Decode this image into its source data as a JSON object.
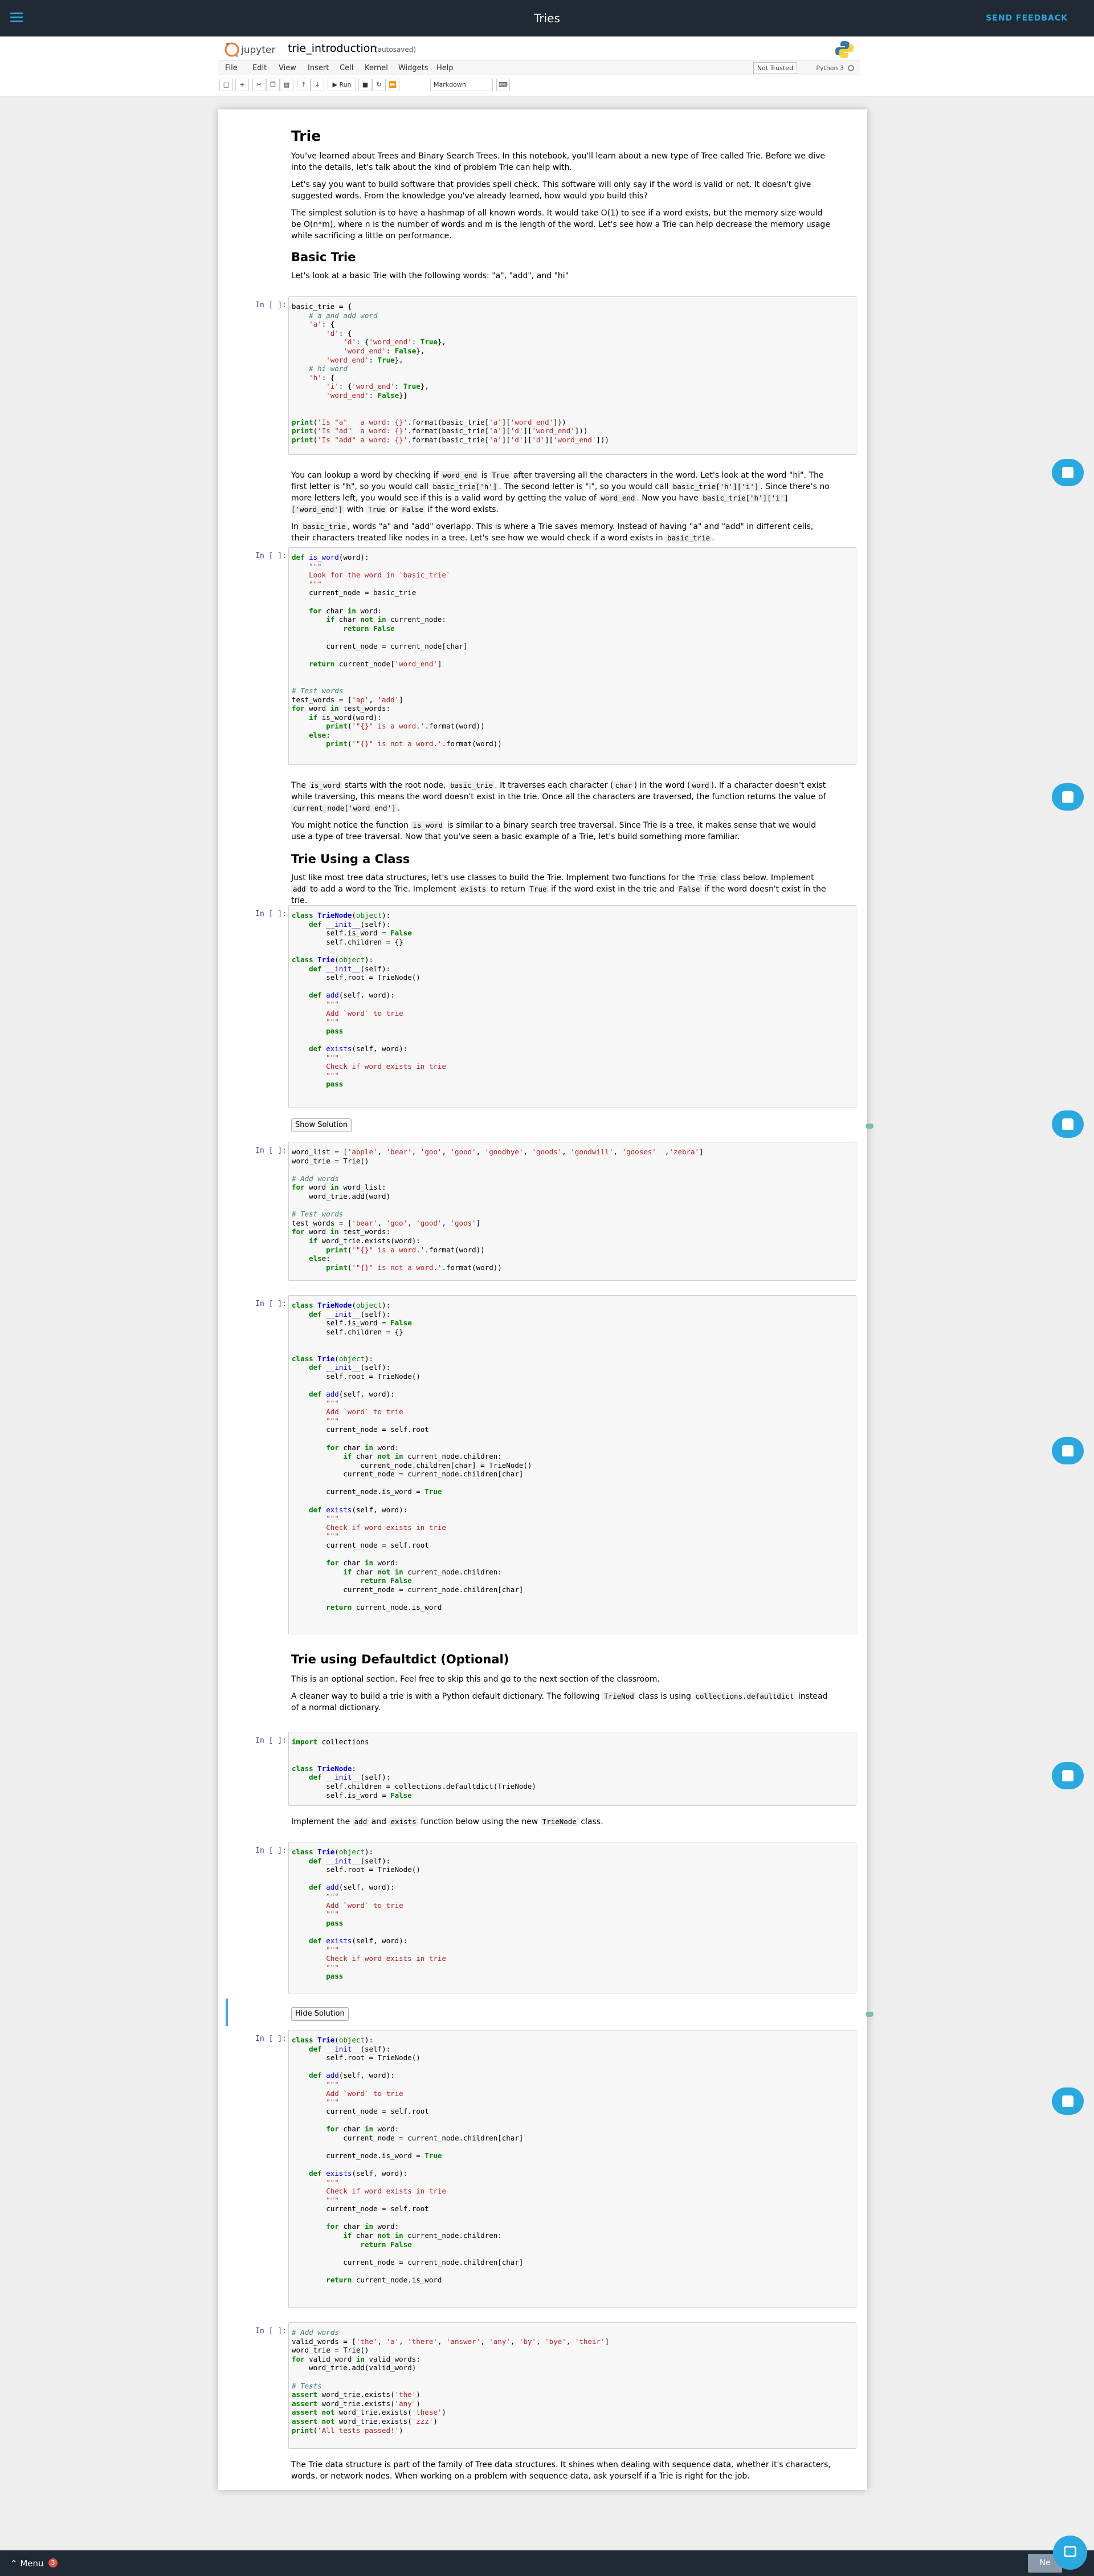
{
  "app": {
    "title": "Tries",
    "feedback": "SEND FEEDBACK",
    "menu_label": "Menu",
    "menu_badge": "3",
    "next_label": "Ne"
  },
  "notebook": {
    "logo_text": "jupyter",
    "name": "trie_introduction",
    "autosave": "(autosaved)",
    "trusted": "Not Trusted",
    "kernel": "Python 3",
    "menus": [
      "File",
      "Edit",
      "View",
      "Insert",
      "Cell",
      "Kernel",
      "Widgets",
      "Help"
    ],
    "cell_type": "Markdown",
    "run_label": "Run"
  },
  "content": {
    "h_trie": "Trie",
    "p1": "You've learned about Trees and Binary Search Trees. In this notebook, you'll learn about a new type of Tree called Trie. Before we dive into the details, let's talk about the kind of problem Trie can help with.",
    "p2": "Let's say you want to build software that provides spell check. This software will only say if the word is valid or not. It doesn't give suggested words. From the knowledge you've already learned, how would you build this?",
    "p3": "The simplest solution is to have a hashmap of all known words. It would take O(1) to see if a word exists, but the memory size would be O(n*m), where n is the number of words and m is the length of the word. Let's see how a Trie can help decrease the memory usage while sacrificing a little on performance.",
    "h_basic": "Basic Trie",
    "p4": "Let's look at a basic Trie with the following words: \"a\", \"add\", and \"hi\"",
    "h_class": "Trie Using a Class",
    "h_dd": "Trie using Defaultdict (Optional)",
    "p_dd1": "This is an optional section. Feel free to skip this and go to the next section of the classroom.",
    "p_final": "The Trie data structure is part of the family of Tree data structures. It shines when dealing with sequence data, whether it's characters, words, or network nodes. When working on a problem with sequence data, ask yourself if a Trie is right for the job."
  },
  "prompts": {
    "empty": "In [ ]:"
  },
  "buttons": {
    "show_solution": "Show Solution",
    "hide_solution": "Hide Solution"
  }
}
